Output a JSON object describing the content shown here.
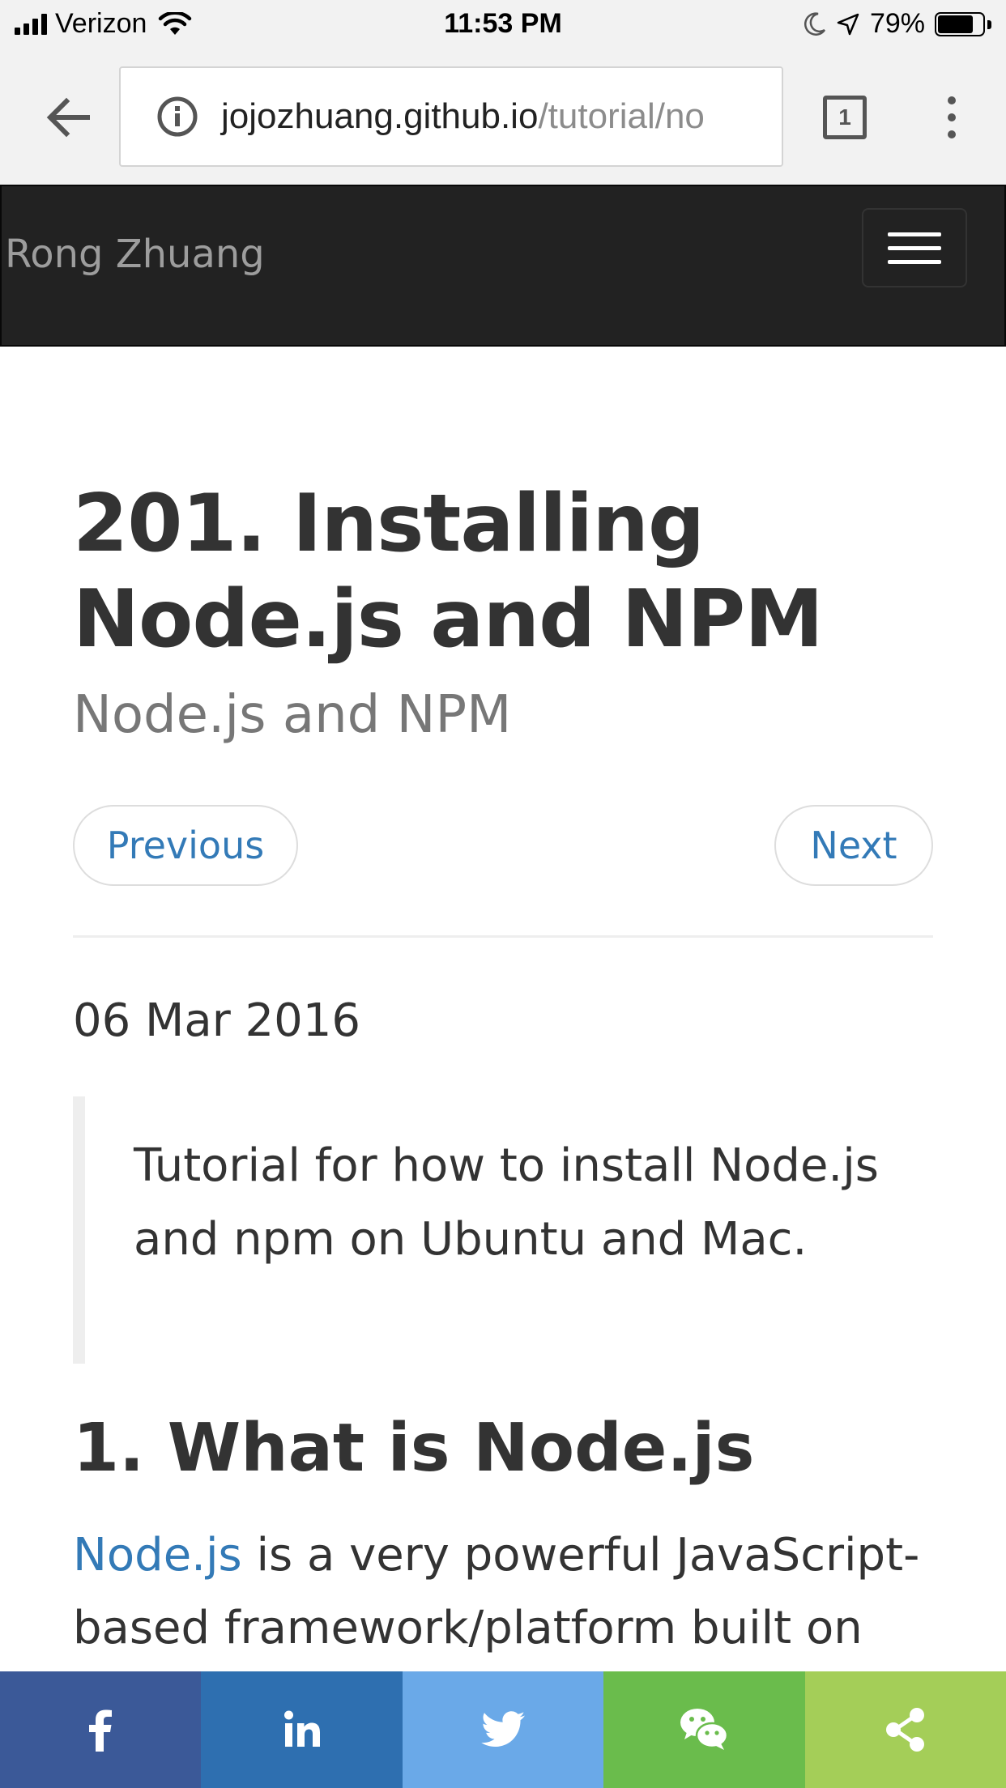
{
  "status_bar": {
    "carrier": "Verizon",
    "time": "11:53 PM",
    "battery_percent": "79%",
    "battery_level": 0.79
  },
  "browser": {
    "url_host": "jojozhuang.github.io",
    "url_path": "/tutorial/no",
    "tab_count": "1"
  },
  "navbar": {
    "brand": "Rong Zhuang"
  },
  "post": {
    "title": "201. Installing Node.js and NPM",
    "subtitle": "Node.js and NPM",
    "previous_label": "Previous",
    "next_label": "Next",
    "date": "06 Mar 2016",
    "summary": "Tutorial for how to install Node.js and npm on Ubuntu and Mac.",
    "section_heading": "1. What is Node.js",
    "paragraph_link": "Node.js",
    "paragraph_text": " is a very powerful JavaScript-based framework/platform built on"
  },
  "share_bar": {
    "buttons": [
      {
        "name": "facebook",
        "icon": "facebook-icon",
        "color": "#3b5998"
      },
      {
        "name": "linkedin",
        "icon": "linkedin-icon",
        "color": "#2e6fb0"
      },
      {
        "name": "twitter",
        "icon": "twitter-icon",
        "color": "#6aa9e8"
      },
      {
        "name": "wechat",
        "icon": "wechat-icon",
        "color": "#6abc4c"
      },
      {
        "name": "share",
        "icon": "share-icon",
        "color": "#a4ce58"
      }
    ]
  },
  "colors": {
    "navbar_bg": "#222222",
    "link": "#337ab7",
    "brand_text": "#9d9d9d"
  }
}
